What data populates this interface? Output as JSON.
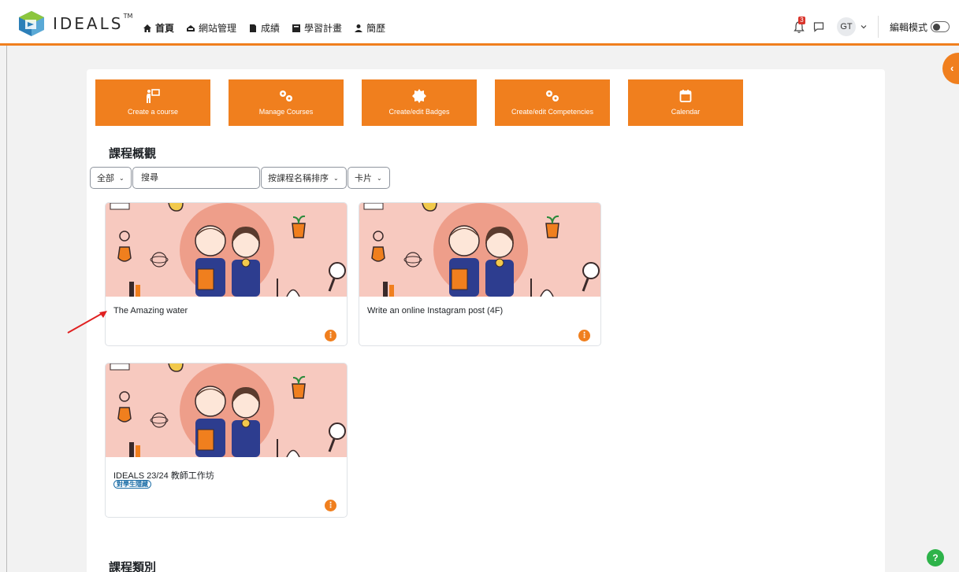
{
  "brand": {
    "name": "IDEALS",
    "trademark": "TM"
  },
  "nav": {
    "items": [
      {
        "label": "首頁",
        "icon": "home-icon"
      },
      {
        "label": "網站管理",
        "icon": "site-admin-icon"
      },
      {
        "label": "成績",
        "icon": "grades-icon"
      },
      {
        "label": "學習計畫",
        "icon": "learning-plan-icon"
      },
      {
        "label": "簡歷",
        "icon": "profile-icon"
      }
    ]
  },
  "user": {
    "notification_count": "3",
    "initials": "GT",
    "edit_mode_label": "編輯模式"
  },
  "quick_actions": [
    {
      "label": "Create a course"
    },
    {
      "label": "Manage Courses"
    },
    {
      "label": "Create/edit Badges"
    },
    {
      "label": "Create/edit Competencies"
    },
    {
      "label": "Calendar"
    }
  ],
  "course_overview": {
    "title": "課程概觀",
    "filter_label": "全部",
    "search_placeholder": "搜尋",
    "sort_label": "按課程名稱排序",
    "view_label": "卡片"
  },
  "courses": [
    {
      "title": "The Amazing water"
    },
    {
      "title": "Write an online Instagram post (4F)"
    },
    {
      "title": "IDEALS 23/24 教師工作坊",
      "tag": "對學生隱藏"
    }
  ],
  "course_categories": {
    "title": "課程類別"
  },
  "colors": {
    "accent": "#f07f1e",
    "card_bg": "#f7c9bf",
    "help": "#2eb34a"
  }
}
